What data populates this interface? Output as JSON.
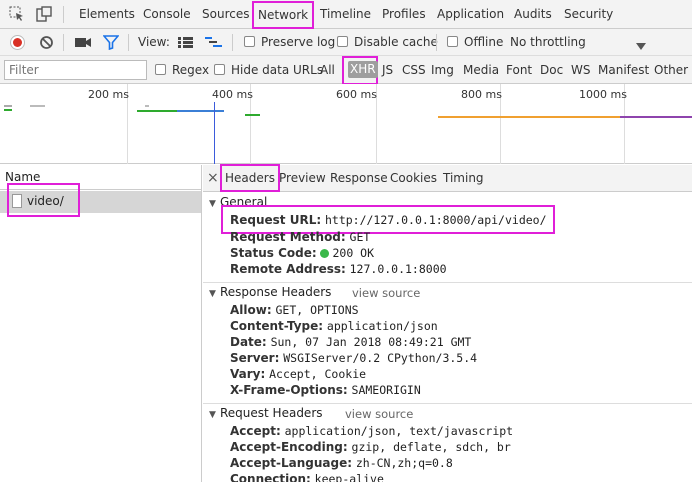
{
  "tabs": [
    "Elements",
    "Console",
    "Sources",
    "Network",
    "Timeline",
    "Profiles",
    "Application",
    "Audits",
    "Security"
  ],
  "active_tab": "Network",
  "toolbar": {
    "view_label": "View:",
    "preserve_log": "Preserve log",
    "disable_cache": "Disable cache",
    "offline": "Offline",
    "throttling": "No throttling"
  },
  "filter": {
    "placeholder": "Filter",
    "regex": "Regex",
    "hide_data_urls": "Hide data URLs",
    "types": [
      "All",
      "XHR",
      "JS",
      "CSS",
      "Img",
      "Media",
      "Font",
      "Doc",
      "WS",
      "Manifest",
      "Other"
    ],
    "active_type": "XHR"
  },
  "timeline": {
    "ticks": [
      "200 ms",
      "400 ms",
      "600 ms",
      "800 ms",
      "1000 ms"
    ]
  },
  "requests": {
    "column_header": "Name",
    "items": [
      "video/"
    ]
  },
  "detail": {
    "close": "×",
    "tabs": [
      "Headers",
      "Preview",
      "Response",
      "Cookies",
      "Timing"
    ],
    "active_tab": "Headers",
    "general": {
      "title": "General",
      "rows": [
        {
          "key": "Request URL:",
          "value": "http://127.0.0.1:8000/api/video/"
        },
        {
          "key": "Request Method:",
          "value": "GET"
        },
        {
          "key": "Status Code:",
          "value": "200 OK"
        },
        {
          "key": "Remote Address:",
          "value": "127.0.0.1:8000"
        }
      ]
    },
    "response_headers": {
      "title": "Response Headers",
      "view_source": "view source",
      "rows": [
        {
          "key": "Allow:",
          "value": "GET, OPTIONS"
        },
        {
          "key": "Content-Type:",
          "value": "application/json"
        },
        {
          "key": "Date:",
          "value": "Sun, 07 Jan 2018 08:49:21 GMT"
        },
        {
          "key": "Server:",
          "value": "WSGIServer/0.2 CPython/3.5.4"
        },
        {
          "key": "Vary:",
          "value": "Accept, Cookie"
        },
        {
          "key": "X-Frame-Options:",
          "value": "SAMEORIGIN"
        }
      ]
    },
    "request_headers": {
      "title": "Request Headers",
      "view_source": "view source",
      "rows": [
        {
          "key": "Accept:",
          "value": "application/json, text/javascript"
        },
        {
          "key": "Accept-Encoding:",
          "value": "gzip, deflate, sdch, br"
        },
        {
          "key": "Accept-Language:",
          "value": "zh-CN,zh;q=0.8"
        },
        {
          "key": "Connection:",
          "value": "keep-alive"
        }
      ]
    }
  },
  "colors": {
    "highlight": "#e01fd8",
    "record": "#d93025",
    "filter_icon": "#1a73e8",
    "status_ok": "#3bb84a"
  }
}
